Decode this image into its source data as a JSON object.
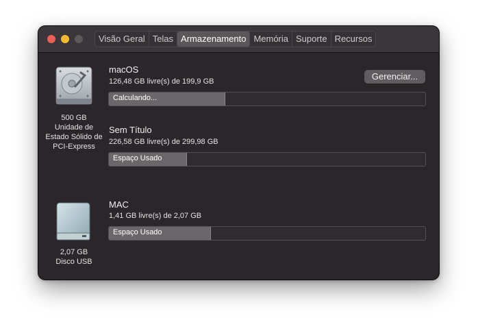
{
  "tabs": [
    "Visão Geral",
    "Telas",
    "Armazenamento",
    "Memória",
    "Suporte",
    "Recursos"
  ],
  "active_tab": "Armazenamento",
  "drives": [
    {
      "icon": "internal-disk-icon",
      "caption": [
        "500 GB",
        "Unidade de",
        "Estado Sólido de",
        "PCI-Express"
      ],
      "volumes": [
        {
          "name": "macOS",
          "free": "126,48 GB livre(s) de 199,9 GB",
          "bar_label": "Calculando...",
          "used_fraction": 0.365
        },
        {
          "name": "Sem Título",
          "free": "226,58 GB livre(s) de 299,98 GB",
          "bar_label": "Espaço Usado",
          "used_fraction": 0.245
        }
      ]
    },
    {
      "icon": "usb-disk-icon",
      "caption": [
        "2,07 GB",
        "Disco USB"
      ],
      "volumes": [
        {
          "name": "MAC",
          "free": "1,41 GB livre(s) de 2,07 GB",
          "bar_label": "Espaço Usado",
          "used_fraction": 0.32
        }
      ]
    }
  ],
  "manage_label": "Gerenciar...",
  "colors": {
    "window_bg": "#2a2629",
    "titlebar_bg": "#3a3639",
    "bar_fill": "#6a6669",
    "close": "#ee5d56",
    "minimize": "#f5bb2e"
  }
}
